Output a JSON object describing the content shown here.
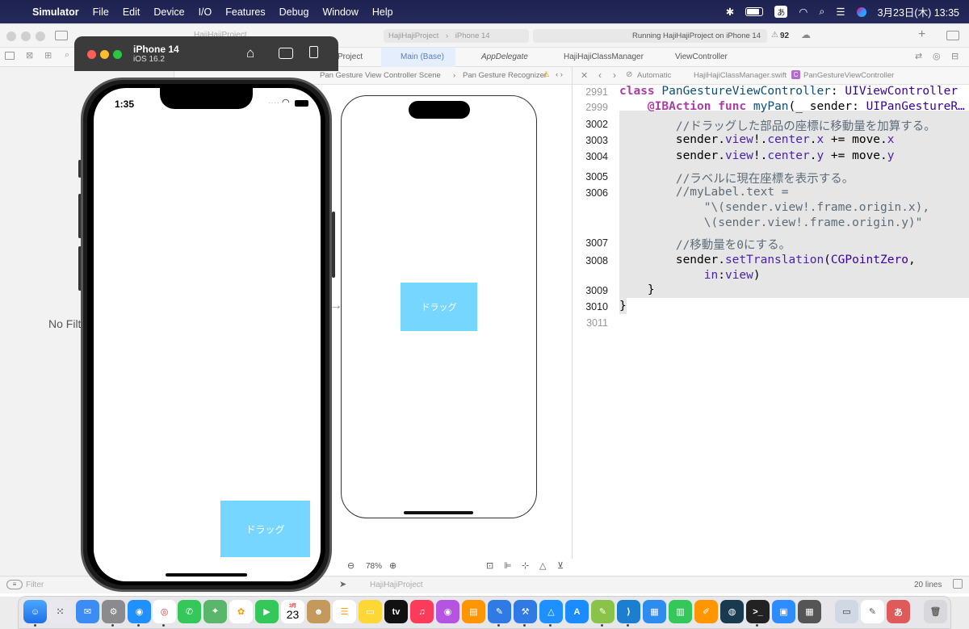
{
  "menubar": {
    "app_name": "Simulator",
    "items": [
      "File",
      "Edit",
      "Device",
      "I/O",
      "Features",
      "Debug",
      "Window",
      "Help"
    ],
    "input_mode": "あ",
    "datetime": "3月23日(木) 13:35"
  },
  "xcode": {
    "toolbar": {
      "project_title": "HajiHajiProject",
      "scheme": "HajiHajiProject",
      "destination": "iPhone 14",
      "status": "Running HajiHajiProject on iPhone 14",
      "warnings": "92"
    },
    "tabs": [
      "Project",
      "Main (Base)",
      "AppDelegate",
      "HajiHajiClassManager",
      "ViewController"
    ],
    "navigator": {
      "empty_text": "No Filter Results",
      "filter_placeholder": "Filter"
    },
    "ib_jumpbar": {
      "crumbs": [
        "Pan Gesture View Controller Scene",
        "Pan Gesture Recognizer"
      ]
    },
    "ib_zoom": "78%",
    "storyboard_label": "ドラッグ",
    "editor_jumpbar": {
      "crumbs": [
        "Automatic",
        "HajiHajiClassManager.swift",
        "PanGestureViewController"
      ]
    },
    "status_bar": {
      "project": "HajiHajiProject",
      "line_count": "20 lines"
    }
  },
  "code": {
    "lines": [
      {
        "num": "2991",
        "text": "class PanGestureViewController: UIViewController"
      },
      {
        "num": "2999",
        "text": "    @IBAction func myPan(_ sender: UIPanGestureR…"
      },
      {
        "num": "3002",
        "text": "        //ドラッグした部品の座標に移動量を加算する。"
      },
      {
        "num": "3003",
        "text": "        sender.view!.center.x += move.x"
      },
      {
        "num": "3004",
        "text": "        sender.view!.center.y += move.y"
      },
      {
        "num": "3005",
        "text": "        //ラベルに現在座標を表示する。"
      },
      {
        "num": "3006",
        "text": "        //myLabel.text ="
      },
      {
        "num": "",
        "text": "            \"\\(sender.view!.frame.origin.x),"
      },
      {
        "num": "",
        "text": "            \\(sender.view!.frame.origin.y)\""
      },
      {
        "num": "3007",
        "text": "        //移動量を0にする。"
      },
      {
        "num": "3008",
        "text": "        sender.setTranslation(CGPointZero,"
      },
      {
        "num": "",
        "text": "            in:view)"
      },
      {
        "num": "3009",
        "text": "    }"
      },
      {
        "num": "3010",
        "text": "}"
      },
      {
        "num": "3011",
        "text": ""
      }
    ]
  },
  "simulator": {
    "device_name": "iPhone 14",
    "os_version": "iOS 16.2",
    "time": "1:35",
    "drag_label": "ドラッグ"
  },
  "dock": {
    "calendar_month": "3月",
    "calendar_day": "23",
    "appletv_label": "tv"
  },
  "colors": {
    "drag_box": "#76d6ff",
    "menubar": "#1d2250",
    "keyword": "#ad3da4",
    "type": "#0b4f79"
  }
}
